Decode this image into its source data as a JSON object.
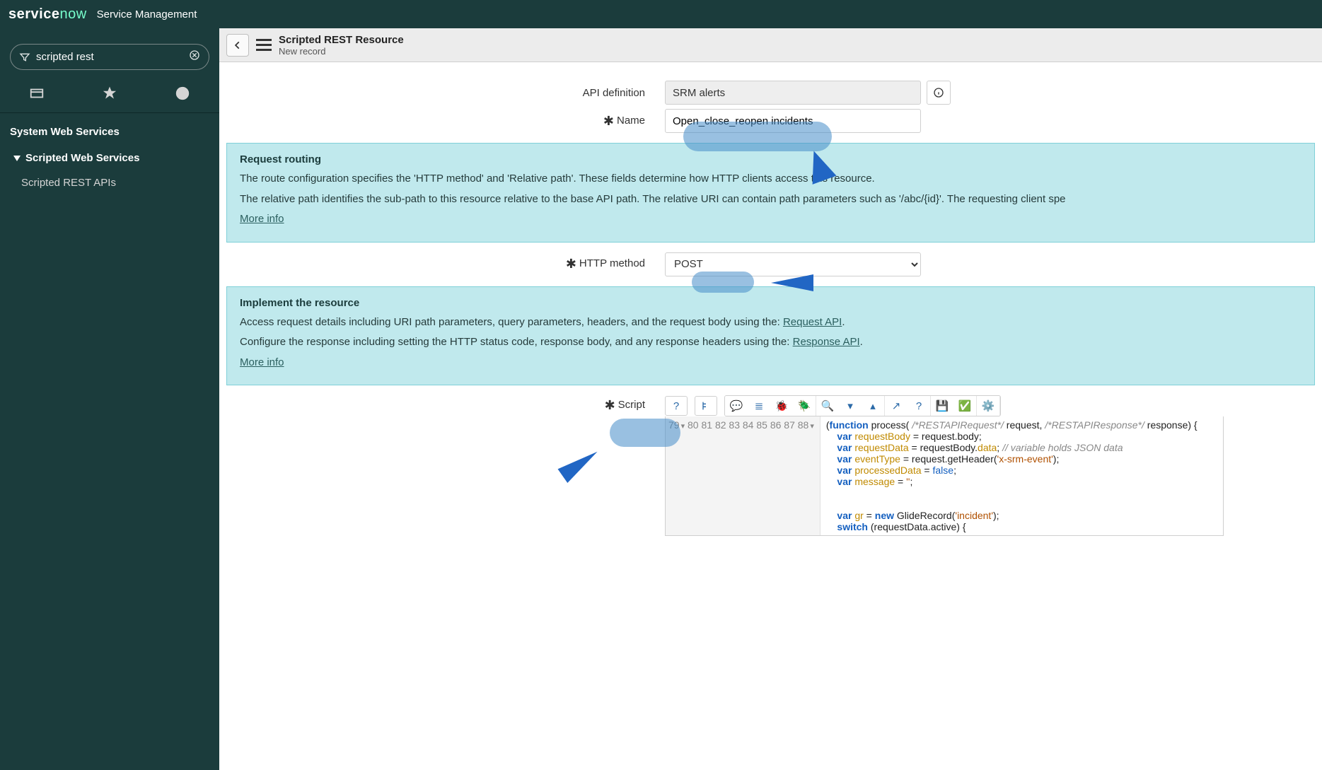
{
  "banner": {
    "logo_a": "service",
    "logo_b": "now",
    "product": "Service Management"
  },
  "nav": {
    "filter_value": "scripted rest",
    "heading": "System Web Services",
    "subheading": "Scripted Web Services",
    "item": "Scripted REST APIs"
  },
  "header": {
    "title": "Scripted REST Resource",
    "subtitle": "New record"
  },
  "labels": {
    "api_definition": "API definition",
    "name": "Name",
    "http_method": "HTTP method",
    "script": "Script"
  },
  "fields": {
    "api_definition": "SRM alerts",
    "name": "Open_close_reopen incidents",
    "http_method": "POST"
  },
  "panels": {
    "routing": {
      "title": "Request routing",
      "p1": "The route configuration specifies the 'HTTP method' and 'Relative path'. These fields determine how HTTP clients access this resource.",
      "p2": "The relative path identifies the sub-path to this resource relative to the base API path. The relative URI can contain path parameters such as '/abc/{id}'. The requesting client spe",
      "more": "More info"
    },
    "implement": {
      "title": "Implement the resource",
      "p1_a": "Access request details including URI path parameters, query parameters, headers, and the request body using the: ",
      "p1_link": "Request API",
      "p2_a": "Configure the response including setting the HTTP status code, response body, and any response headers using the: ",
      "p2_link": "Response API",
      "more": "More info"
    }
  },
  "code": {
    "line_numbers": [
      "79",
      "80",
      "81",
      "82",
      "83",
      "84",
      "85",
      "86",
      "87",
      "88"
    ],
    "fold_open": [
      "79",
      "88"
    ]
  }
}
